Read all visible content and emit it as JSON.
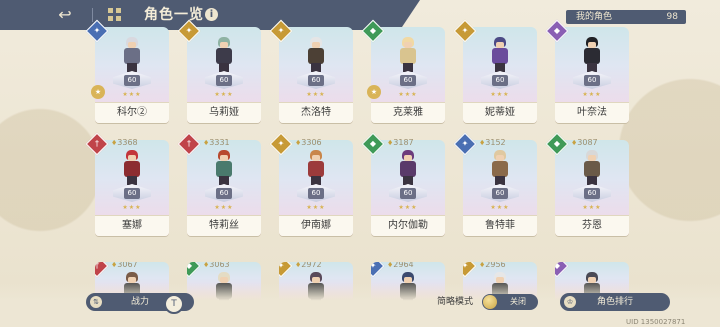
{
  "header": {
    "title": "角色一览",
    "back_icon": "back-arrow-icon",
    "grid_icon": "grid-icon",
    "info_icon": "i"
  },
  "my_characters": {
    "label": "我的角色",
    "count": "98"
  },
  "colors": {
    "header_bg": "#4f5b72",
    "background": "#ede6d4",
    "class_red": "#c0444a",
    "class_green": "#3f9a58",
    "class_gold": "#c79a36",
    "class_blue": "#4a6fb3",
    "class_purple": "#8a5fb4"
  },
  "row1": [
    {
      "name": "科尔②",
      "level": "60",
      "class": "blue",
      "class_icon": "✦",
      "hair": "#d9d9df",
      "outfit": "#6b6f86",
      "badge": "★"
    },
    {
      "name": "乌莉娅",
      "level": "60",
      "class": "gold",
      "class_icon": "✦",
      "hair": "#8fb3a3",
      "outfit": "#3d3b4a",
      "badge": ""
    },
    {
      "name": "杰洛特",
      "level": "60",
      "class": "gold",
      "class_icon": "✦",
      "hair": "#e5e5e5",
      "outfit": "#4c4035",
      "badge": ""
    },
    {
      "name": "克莱雅",
      "level": "60",
      "class": "green",
      "class_icon": "◆",
      "hair": "#f1d9a4",
      "outfit": "#d9c48f",
      "badge": "★"
    },
    {
      "name": "妮蒂娅",
      "level": "60",
      "class": "gold",
      "class_icon": "✦",
      "hair": "#4d4b86",
      "outfit": "#6a4c9c",
      "badge": ""
    },
    {
      "name": "叶奈法",
      "level": "60",
      "class": "purple",
      "class_icon": "◆",
      "hair": "#222226",
      "outfit": "#2b2b33",
      "badge": ""
    }
  ],
  "row2": [
    {
      "name": "塞娜",
      "power": "3368",
      "level": "60",
      "class": "red",
      "class_icon": "†",
      "hair": "#c3353a",
      "outfit": "#8c2c30"
    },
    {
      "name": "特莉丝",
      "power": "3331",
      "level": "60",
      "class": "red",
      "class_icon": "†",
      "hair": "#b84a2f",
      "outfit": "#4a7a6d"
    },
    {
      "name": "伊南娜",
      "power": "3306",
      "level": "60",
      "class": "gold",
      "class_icon": "✦",
      "hair": "#c9864a",
      "outfit": "#9c3b3b"
    },
    {
      "name": "内尔伽勒",
      "power": "3187",
      "level": "60",
      "class": "green",
      "class_icon": "◆",
      "hair": "#6c3c7c",
      "outfit": "#5a3a6a"
    },
    {
      "name": "鲁特菲",
      "power": "3152",
      "level": "60",
      "class": "blue",
      "class_icon": "✦",
      "hair": "#e0c9a0",
      "outfit": "#8a6a4a"
    },
    {
      "name": "芬恩",
      "power": "3087",
      "level": "60",
      "class": "green",
      "class_icon": "◆",
      "hair": "#d8d8d8",
      "outfit": "#6a5a48"
    }
  ],
  "row3": [
    {
      "power": "3067",
      "class": "red",
      "class_icon": "†",
      "hair": "#7a5c48"
    },
    {
      "power": "3063",
      "class": "green",
      "class_icon": "◆",
      "hair": "#e4dcc4"
    },
    {
      "power": "2972",
      "class": "gold",
      "class_icon": "✦",
      "hair": "#5a4a5a"
    },
    {
      "power": "2964",
      "class": "blue",
      "class_icon": "✦",
      "hair": "#3c4a6e"
    },
    {
      "power": "2956",
      "class": "gold",
      "class_icon": "✦",
      "hair": "#e7e7e7"
    },
    {
      "power": "",
      "class": "purple",
      "class_icon": "◆",
      "hair": "#4a4a55"
    }
  ],
  "bottom": {
    "sort_label": "战力",
    "sort_icon": "sort-icon",
    "filter_icon": "T",
    "simple_mode_label": "简略模式",
    "toggle_state": "关闭",
    "rank_label": "角色排行",
    "uid": "UID 1350027871"
  }
}
